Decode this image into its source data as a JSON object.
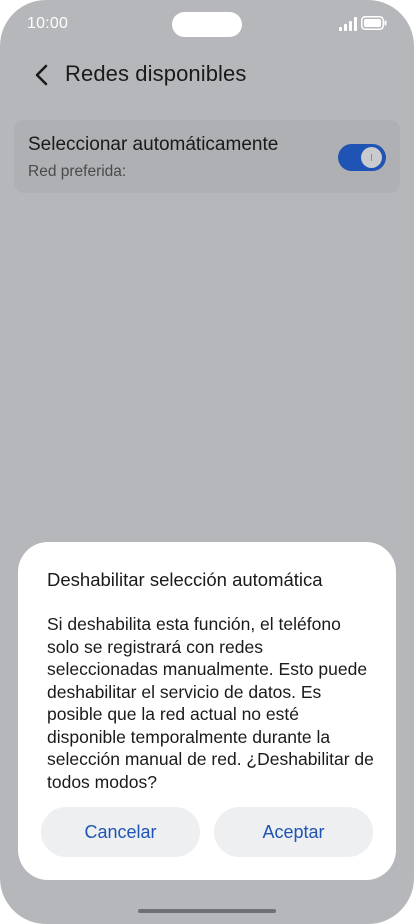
{
  "status_bar": {
    "time": "10:00"
  },
  "header": {
    "title": "Redes disponibles",
    "back_icon": "chevron-left-icon"
  },
  "setting": {
    "title": "Seleccionar automáticamente",
    "subtitle": "Red preferida:",
    "toggle_on": true,
    "toggle_color": "#1f54b4"
  },
  "dialog": {
    "title": "Deshabilitar selección automática",
    "message": "Si deshabilita esta función, el teléfono solo se registrará con redes seleccionadas manualmente. Esto puede deshabilitar el servicio de datos. Es posible que la red actual no esté disponible temporalmente durante la selección manual de red. ¿Deshabilitar de todos modos?",
    "cancel_label": "Cancelar",
    "accept_label": "Aceptar",
    "accent_color": "#1f54b4"
  }
}
